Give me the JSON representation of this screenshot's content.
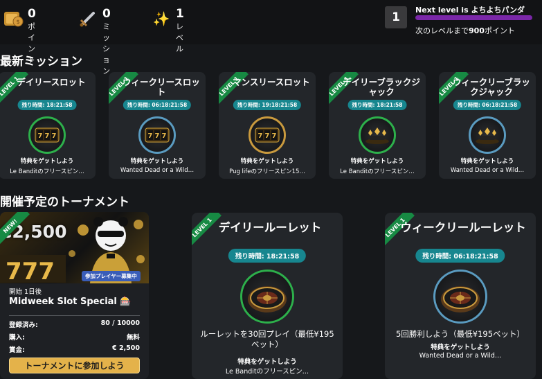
{
  "header": {
    "stats": [
      {
        "value": "0",
        "label": "ポイント",
        "icon": "points-icon"
      },
      {
        "value": "0",
        "label": "ミッション",
        "icon": "sword-icon"
      },
      {
        "value": "1",
        "label": "レベル",
        "icon": "sparkle-icon"
      }
    ],
    "level_badge": "1",
    "next_level_prefix": "Next level is",
    "next_level_name": "よちよちパンダ",
    "next_level_progress": 0,
    "points_prefix": "次のレベルまで",
    "points_needed": "900",
    "points_suffix": "ポイント"
  },
  "missions_section": {
    "title": "最新ミッション",
    "cards": [
      {
        "ribbon": "LEVEL 1",
        "title": "デイリースロット",
        "timer": "残り時間: 18:21:58",
        "get": "特典をゲットしよう",
        "desc": "Le Banditのフリースピン…",
        "ring": "green",
        "icon": "slot-machine-icon"
      },
      {
        "ribbon": "LEVEL 1",
        "title": "ウィークリースロット",
        "timer": "残り時間: 06:18:21:58",
        "get": "特典をゲットしよう",
        "desc": "Wanted Dead or a Wild…",
        "ring": "blue",
        "icon": "slot-machine-icon"
      },
      {
        "ribbon": "LEVEL 1",
        "title": "マンスリースロット",
        "timer": "残り時間: 19:18:21:58",
        "get": "特典をゲットしよう",
        "desc": "Pug lifeのフリースピン15…",
        "ring": "gold",
        "icon": "slot-machine-icon"
      },
      {
        "ribbon": "LEVEL 1",
        "title": "デイリーブラックジャック",
        "timer": "残り時間: 18:21:58",
        "get": "特典をゲットしよう",
        "desc": "Le Banditのフリースピン…",
        "ring": "green",
        "icon": "cards-icon"
      },
      {
        "ribbon": "LEVEL 1",
        "title": "ウィークリーブラックジャック",
        "timer": "残り時間: 06:18:21:58",
        "get": "特典をゲットしよう",
        "desc": "Wanted Dead or a Wild…",
        "ring": "blue",
        "icon": "cards-icon"
      }
    ]
  },
  "tournaments_section": {
    "title": "開催予定のトーナメント",
    "featured": {
      "ribbon": "NEW!",
      "prize": "€2,500",
      "recruit_badge": "参加プレイヤー募集中",
      "starts": "開始 1日後",
      "name": "Midweek Slot Special 🎰",
      "rows": [
        {
          "label": "登録済み:",
          "value": "80 / 10000"
        },
        {
          "label": "購入:",
          "value": "無料"
        },
        {
          "label": "賞金:",
          "value": "€ 2,500"
        }
      ],
      "join_label": "トーナメントに参加しよう"
    },
    "roulette_cards": [
      {
        "ribbon": "LEVEL 1",
        "title": "デイリールーレット",
        "timer": "残り時間: 18:21:58",
        "task": "ルーレットを30回プレイ（最低¥195ベット）",
        "get": "特典をゲットしよう",
        "desc": "Le Banditのフリースピン…",
        "ring": "green"
      },
      {
        "ribbon": "LEVEL 1",
        "title": "ウィークリールーレット",
        "timer": "残り時間: 06:18:21:58",
        "task": "5回勝利しよう（最低¥195ベット）",
        "get": "特典をゲットしよう",
        "desc": "Wanted Dead or a Wild…",
        "ring": "blue"
      }
    ]
  },
  "colors": {
    "accent_purple": "#7a27a8",
    "timer_teal": "#17868f",
    "ribbon_green": "#178a43",
    "join_gold": "#e4b24a"
  }
}
